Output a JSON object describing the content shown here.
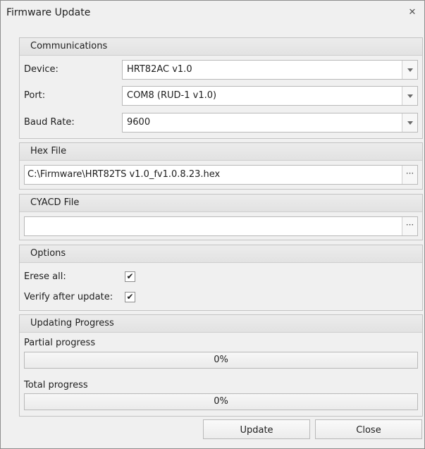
{
  "window": {
    "title": "Firmware Update",
    "close_glyph": "✕"
  },
  "communications": {
    "header": "Communications",
    "device_label": "Device:",
    "device_value": "HRT82AC v1.0",
    "port_label": "Port:",
    "port_value": "COM8 (RUD-1 v1.0)",
    "baud_label": "Baud Rate:",
    "baud_value": "9600"
  },
  "hex_file": {
    "header": "Hex File",
    "path": "C:\\Firmware\\HRT82TS v1.0_fv1.0.8.23.hex",
    "browse_label": "···"
  },
  "cyacd_file": {
    "header": "CYACD File",
    "path": "",
    "browse_label": "···"
  },
  "options": {
    "header": "Options",
    "erase_label": "Erese all:",
    "erase_checked": true,
    "verify_label": "Verify after update:",
    "verify_checked": true,
    "check_glyph": "✔"
  },
  "progress": {
    "header": "Updating Progress",
    "partial_label": "Partial progress",
    "partial_value": 0,
    "partial_text": "0%",
    "total_label": "Total progress",
    "total_value": 0,
    "total_text": "0%"
  },
  "buttons": {
    "update": "Update",
    "close": "Close"
  },
  "icons": {
    "dropdown": "chevron-down-icon",
    "browse": "ellipsis-icon",
    "close": "close-icon",
    "check": "checkmark-icon"
  },
  "colors": {
    "window_bg": "#f0f0f0",
    "panel_header": "#e6e6e6",
    "border": "#b9b9b9"
  }
}
